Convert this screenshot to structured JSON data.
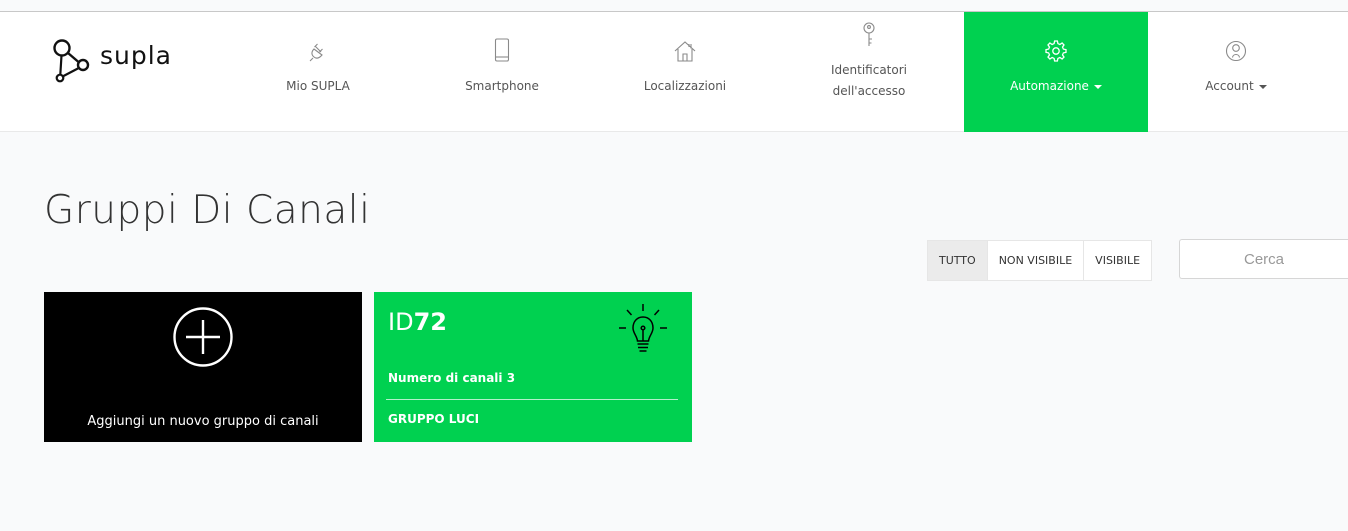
{
  "brand": {
    "name": "supla"
  },
  "nav": {
    "items": [
      {
        "label": "Mio SUPLA",
        "icon": "plug-icon"
      },
      {
        "label": "Smartphone",
        "icon": "smartphone-icon"
      },
      {
        "label": "Localizzazioni",
        "icon": "home-icon"
      },
      {
        "label": "Identificatori dell'accesso",
        "line1": "Identificatori",
        "line2": "dell'accesso",
        "icon": "key-icon"
      },
      {
        "label": "Automazione",
        "icon": "gear-icon",
        "active": true,
        "dropdown": true
      },
      {
        "label": "Account",
        "icon": "user-icon",
        "dropdown": true
      }
    ]
  },
  "page": {
    "title": "Gruppi Di Canali"
  },
  "filters": {
    "options": [
      "TUTTO",
      "NON VISIBILE",
      "VISIBILE"
    ],
    "selected": "TUTTO"
  },
  "search": {
    "placeholder": "Cerca",
    "value": ""
  },
  "add_tile": {
    "label": "Aggiungi un nuovo gruppo di canali"
  },
  "groups": [
    {
      "id_prefix": "ID",
      "id_number": "72",
      "count_text": "Numero di canali 3",
      "caption": "GRUPPO LUCI",
      "icon": "lightbulb-icon"
    }
  ],
  "colors": {
    "accent": "#00d150",
    "dark_tile": "#000000",
    "background": "#f9fafb",
    "nav_bg": "#ffffff"
  }
}
